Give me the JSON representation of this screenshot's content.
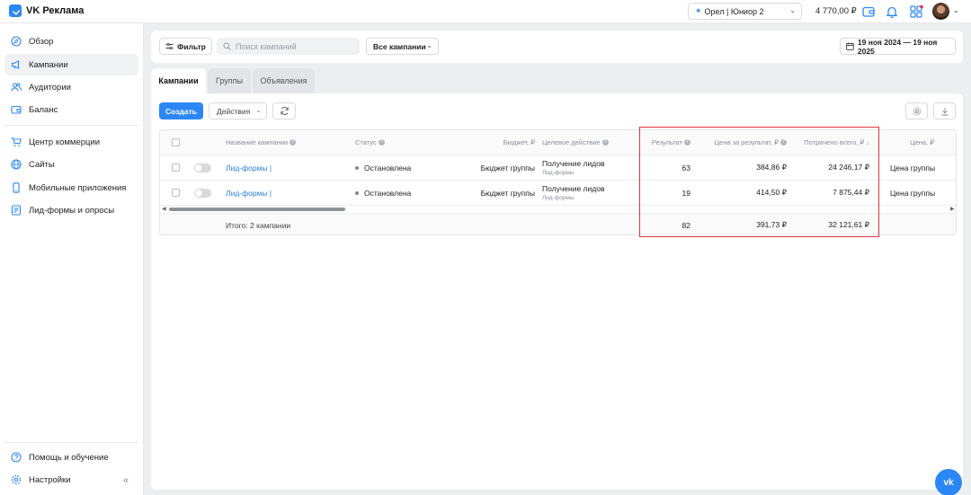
{
  "app": {
    "title": "VK Реклама"
  },
  "header": {
    "account": "Орел | Юниор 2",
    "balance": "4 770,00 ₽"
  },
  "sidebar": {
    "items": [
      {
        "label": "Обзор",
        "icon": "compass-icon"
      },
      {
        "label": "Кампании",
        "icon": "megaphone-icon",
        "active": true
      },
      {
        "label": "Аудитории",
        "icon": "users-icon"
      },
      {
        "label": "Баланс",
        "icon": "wallet-icon"
      },
      {
        "label": "Центр коммерции",
        "icon": "cart-icon"
      },
      {
        "label": "Сайты",
        "icon": "globe-icon"
      },
      {
        "label": "Мобильные приложения",
        "icon": "phone-icon"
      },
      {
        "label": "Лид-формы и опросы",
        "icon": "form-icon"
      }
    ],
    "bottom": [
      {
        "label": "Помощь и обучение",
        "icon": "help-icon"
      },
      {
        "label": "Настройки",
        "icon": "settings-icon"
      }
    ]
  },
  "filters": {
    "filter_label": "Фильтр",
    "search_placeholder": "Поиск кампаний",
    "campaign_select": "Все кампании",
    "date_range": "19 ноя 2024 — 19 ноя 2025"
  },
  "tabs": [
    {
      "label": "Кампании",
      "active": true
    },
    {
      "label": "Группы"
    },
    {
      "label": "Объявления"
    }
  ],
  "toolbar": {
    "create_label": "Создать",
    "actions_label": "Действия"
  },
  "table": {
    "headers": {
      "name": "Название кампании",
      "status": "Статус",
      "budget": "Бюджет, ₽",
      "goal": "Целевое действие",
      "result": "Результат",
      "cpr": "Цена за результат, ₽",
      "spent": "Потрачено всего, ₽",
      "price": "Цена, ₽"
    },
    "rows": [
      {
        "name": "Лид-формы |",
        "status": "Остановлена",
        "budget": "Бюджет группы",
        "goal": "Получение лидов",
        "goal_sub": "Лид-формы",
        "result": "63",
        "cpr": "384,86 ₽",
        "spent": "24 246,17 ₽",
        "price": "Цена группы"
      },
      {
        "name": "Лид-формы |",
        "status": "Остановлена",
        "budget": "Бюджет группы",
        "goal": "Получение лидов",
        "goal_sub": "Лид-формы",
        "result": "19",
        "cpr": "414,50 ₽",
        "spent": "7 875,44 ₽",
        "price": "Цена группы"
      }
    ],
    "total": {
      "label": "Итого: 2 кампании",
      "result": "82",
      "cpr": "391,73 ₽",
      "spent": "32 121,61 ₽"
    }
  },
  "colors": {
    "accent": "#2b87f5",
    "highlight": "#e0333c"
  }
}
